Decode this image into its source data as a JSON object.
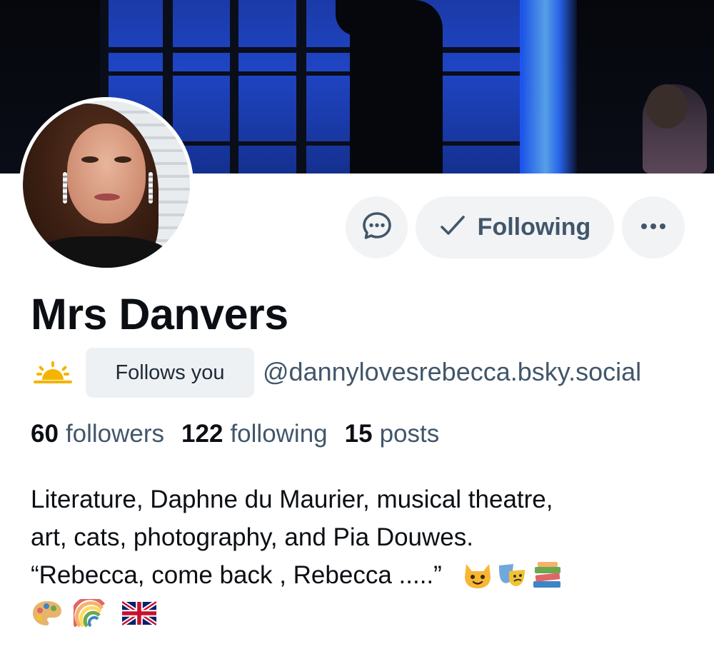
{
  "profile": {
    "display_name": "Mrs Danvers",
    "follows_you_badge": "Follows you",
    "handle": "@dannylovesrebecca.bsky.social"
  },
  "actions": {
    "following_label": "Following"
  },
  "stats": {
    "followers_count": "60",
    "followers_label": "followers",
    "following_count": "122",
    "following_label": "following",
    "posts_count": "15",
    "posts_label": "posts"
  },
  "bio": {
    "line1": "Literature, Daphne du Maurier,  musical theatre,",
    "line2": "art, cats, photography, and Pia Douwes.",
    "line3": "“Rebecca, come back , Rebecca .....”"
  },
  "icons": {
    "status": "sun-icon",
    "message": "chat-bubble-icon",
    "following": "check-icon",
    "more": "more-dots-icon",
    "bio_emojis": [
      "cat-face-icon",
      "performing-arts-icon",
      "books-icon",
      "palette-icon",
      "rainbow-icon",
      "uk-flag-icon"
    ]
  },
  "colors": {
    "text_primary": "#0b0f14",
    "text_secondary": "#42566a",
    "button_bg": "#f1f3f5",
    "badge_bg": "#eef1f4",
    "sun_yellow": "#f5b400"
  }
}
